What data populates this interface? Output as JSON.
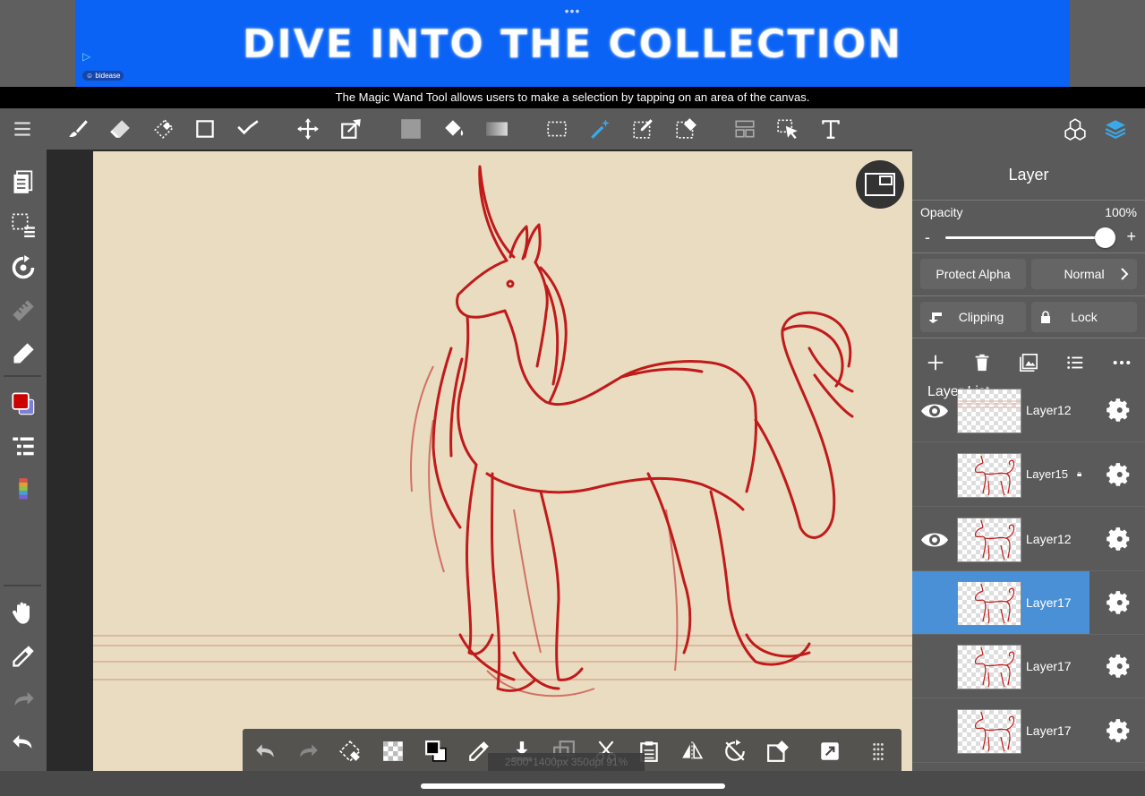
{
  "ad": {
    "dots": "•••",
    "headline": "DIVE INTO THE COLLECTION",
    "play_glyph": "▷",
    "brand": "bidease",
    "bg_color": "#0a63f5"
  },
  "tip": {
    "text": "The Magic Wand Tool allows users to make a selection by tapping on an area of the canvas."
  },
  "top_toolbar": {
    "icons": [
      "menu-icon",
      "brush-icon",
      "eraser-icon",
      "blur-eraser-icon",
      "rectangle-icon",
      "polyline-icon",
      "move-icon",
      "transform-icon",
      "fill-color-icon",
      "bucket-icon",
      "gradient-icon",
      "select-rect-icon",
      "magic-wand-icon",
      "select-pen-icon",
      "select-eraser-icon",
      "layout-icon",
      "select-layer-icon",
      "text-icon",
      "materials-icon",
      "layers-icon"
    ],
    "active": "magic-wand-icon",
    "accent_color": "#3aa9e8"
  },
  "left_toolbar": {
    "icons": [
      "pages-icon",
      "selection-icon",
      "rotate-icon",
      "ruler-icon",
      "pen-icon",
      "color-swatch-icon",
      "layer-list-icon",
      "palette-icon",
      "hand-icon",
      "eyedropper-icon",
      "redo-icon",
      "undo-icon"
    ],
    "primary_color": "#cc0000",
    "secondary_color": "#7b7fd6"
  },
  "bottom_toolbar": {
    "icons": [
      "undo-icon",
      "redo-icon",
      "transform-select-icon",
      "transparent-icon",
      "swap-color-icon",
      "eyedropper-icon",
      "import-icon",
      "copy-icon",
      "cut-icon",
      "paste-icon",
      "flip-icon",
      "rotate-off-icon",
      "clear-icon",
      "fullscreen-icon",
      "grid-icon"
    ]
  },
  "status": {
    "text": "2500*1400px 350dpi 91%"
  },
  "layer_panel": {
    "title": "Layer",
    "opacity_label": "Opacity",
    "opacity_value": "100%",
    "opacity_fraction": 1.0,
    "minus": "-",
    "plus": "+",
    "protect_alpha": "Protect Alpha",
    "blend_mode": "Normal",
    "clipping": "Clipping",
    "lock": "Lock",
    "list_title": "Layer List",
    "layers": [
      {
        "name": "Layer12",
        "visible": true,
        "selected": false,
        "locked": false,
        "thumb": "lines"
      },
      {
        "name": "Layer15",
        "visible": false,
        "selected": false,
        "locked": true,
        "thumb": "unicorn"
      },
      {
        "name": "Layer12",
        "visible": true,
        "selected": false,
        "locked": false,
        "thumb": "unicorn"
      },
      {
        "name": "Layer17",
        "visible": false,
        "selected": true,
        "locked": false,
        "thumb": "unicorn"
      },
      {
        "name": "Layer17",
        "visible": false,
        "selected": false,
        "locked": false,
        "thumb": "unicorn"
      },
      {
        "name": "Layer17",
        "visible": false,
        "selected": false,
        "locked": false,
        "thumb": "unicorn"
      }
    ],
    "selected_color": "#4a90d6"
  },
  "canvas": {
    "paper_color": "#e9dcc1",
    "ink_color": "#c01a1a"
  }
}
